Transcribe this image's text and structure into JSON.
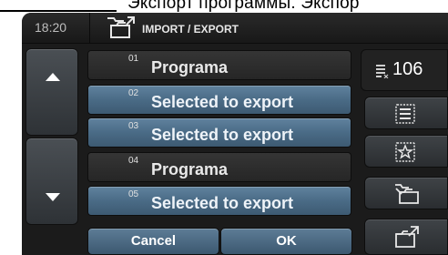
{
  "header": {
    "time": "18:20",
    "title": "IMPORT / EXPORT",
    "top_text": "Экспорт программы. Экспор"
  },
  "program_list": [
    {
      "number": "01",
      "label": "Programa",
      "state": "normal"
    },
    {
      "number": "02",
      "label": "Selected to export",
      "state": "selected"
    },
    {
      "number": "03",
      "label": "Selected to export",
      "state": "selected"
    },
    {
      "number": "04",
      "label": "Programa",
      "state": "normal"
    },
    {
      "number": "05",
      "label": "Selected to export",
      "state": "selected"
    }
  ],
  "buttons": {
    "cancel": "Cancel",
    "ok": "OK"
  },
  "side_panel": {
    "count": "106",
    "count_icon": "list-count-icon",
    "items": [
      {
        "name": "select-all-icon"
      },
      {
        "name": "favorite-star-icon"
      },
      {
        "name": "folder-import-icon"
      },
      {
        "name": "folder-export-icon"
      }
    ]
  },
  "colors": {
    "selected_row": "#4a6b86",
    "normal_row": "#2e2e2e",
    "background": "#1b1b1b",
    "text": "#e9e9e9"
  }
}
